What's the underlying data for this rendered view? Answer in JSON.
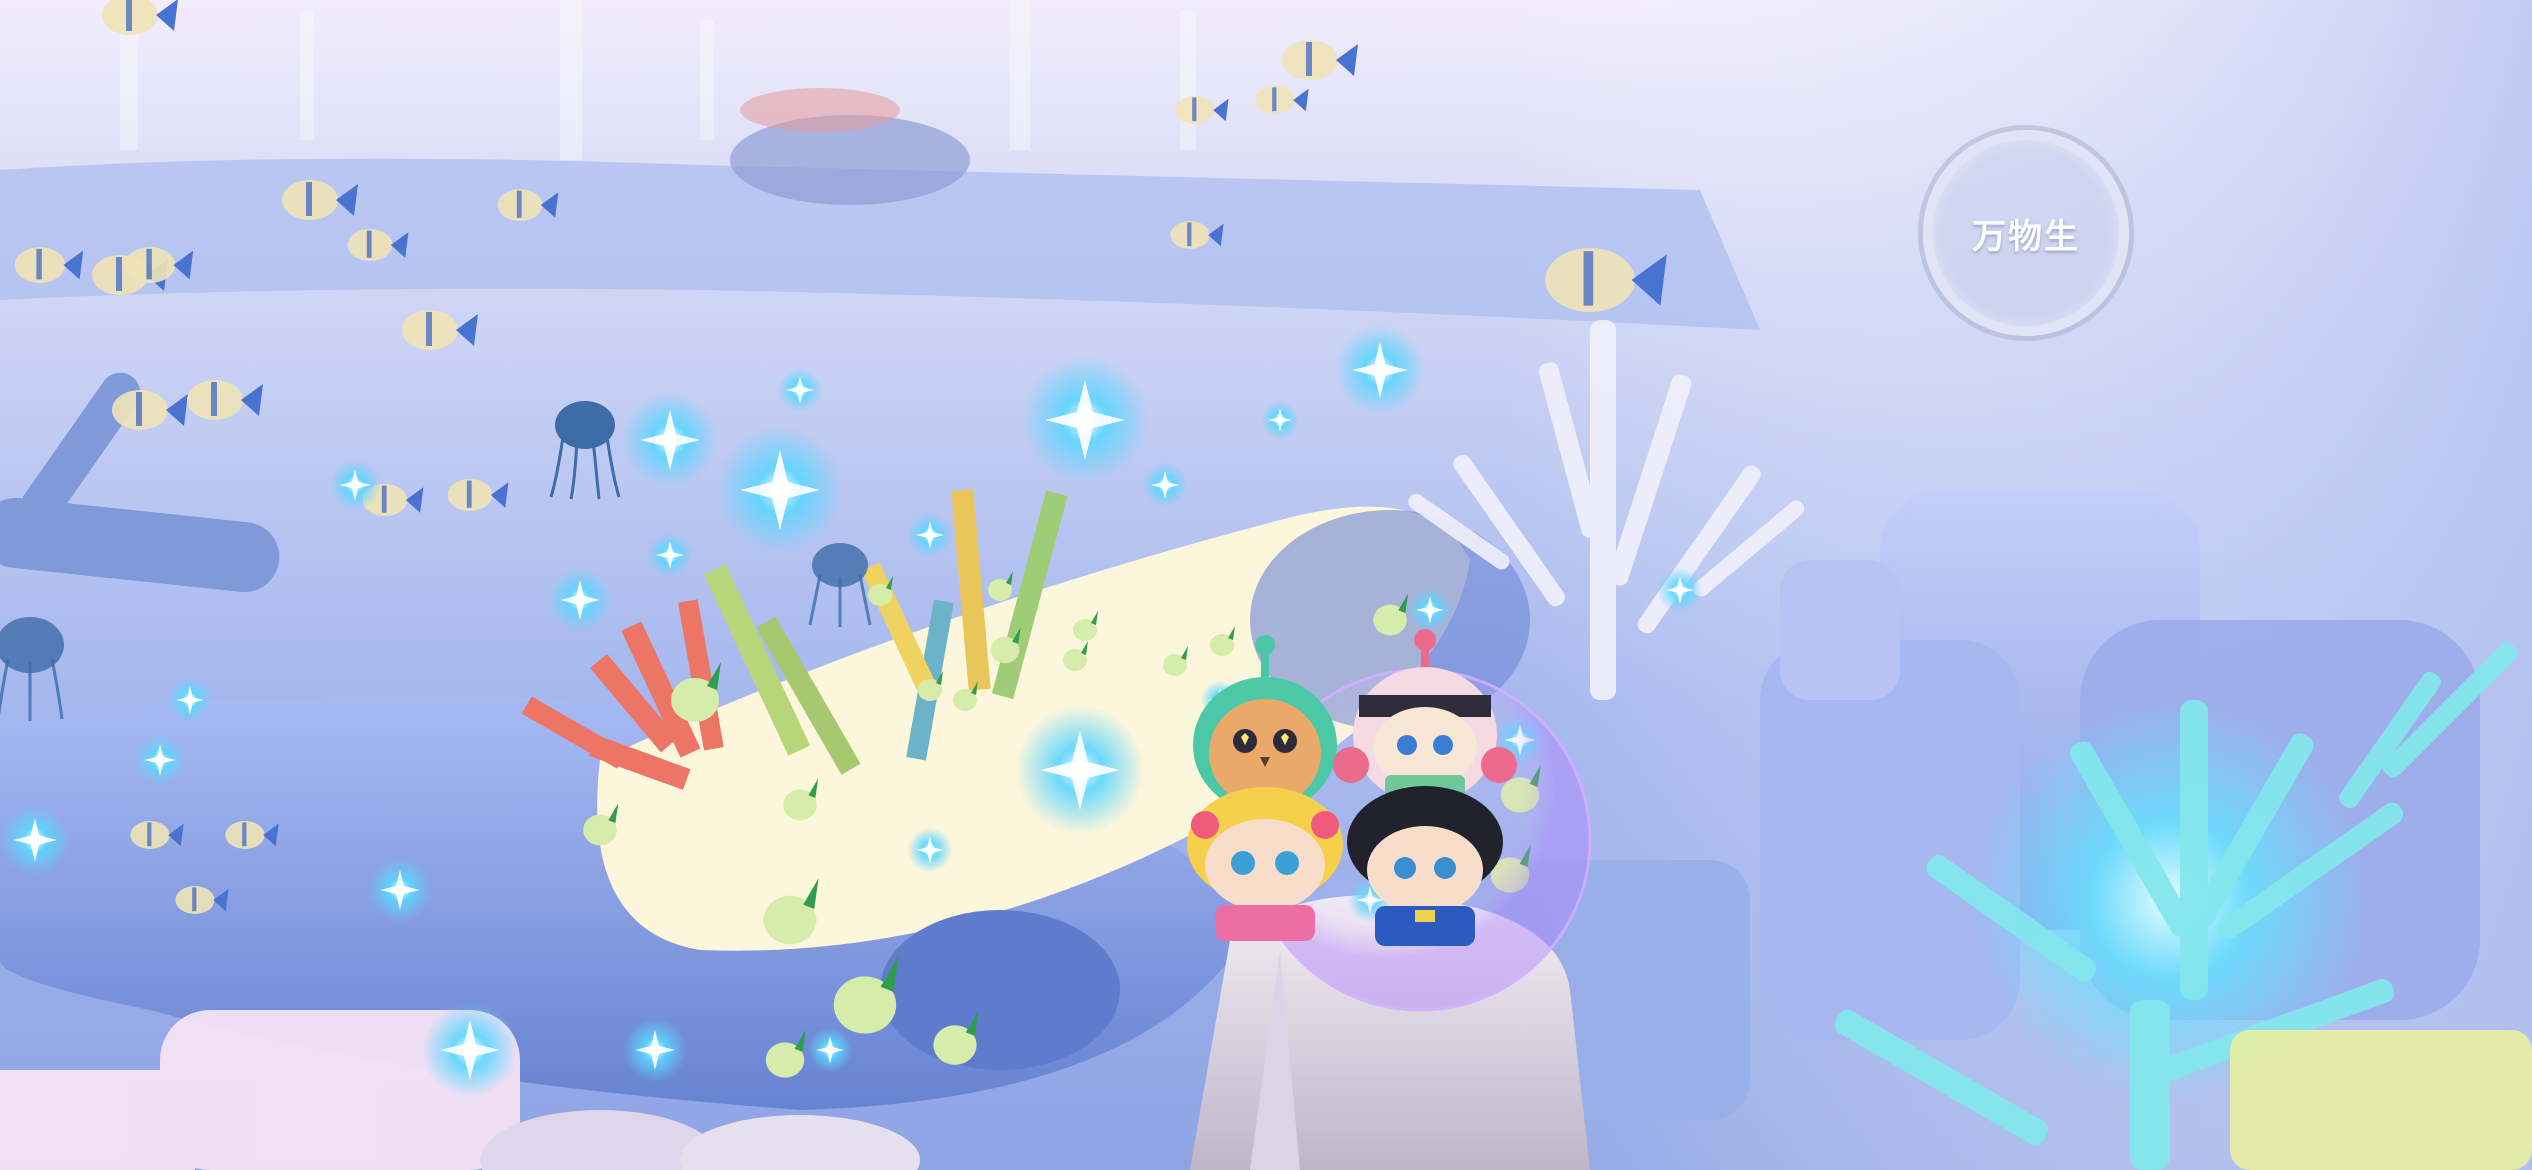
{
  "hud": {
    "spawn_button_label": "万物生"
  },
  "scene": {
    "palette": {
      "sky_top": "#efe9fb",
      "water": "#9bb2ee",
      "whale_body": "#7f9be0",
      "whale_belly": "#fbf6dd",
      "coral_red": "#ee7b6a",
      "coral_green": "#a9cf70",
      "coral_cyan": "#7fe8ea",
      "sparkle": "#4fd2ff",
      "bubble": "#c9a9f2"
    }
  }
}
